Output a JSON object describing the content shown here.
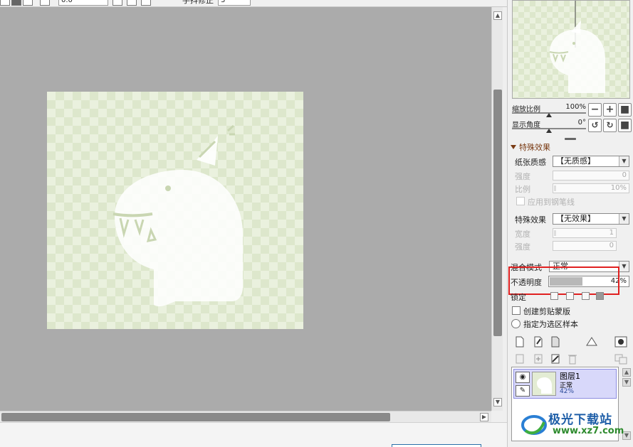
{
  "toolbar": {
    "zoom_field": "0.0",
    "stabilizer_label": "手抖修正",
    "stabilizer_value": "3"
  },
  "navigator": {
    "zoom_label": "缩放比例",
    "zoom_value": "100%",
    "angle_label": "显示角度",
    "angle_value": "0°"
  },
  "special_effects": {
    "section_title": "特殊效果",
    "paper_texture_label": "纸张质感",
    "paper_texture_value": "【无质感】",
    "strength_label": "强度",
    "strength_value": "0",
    "scale_label": "比例",
    "scale_value": "10%",
    "apply_to_pen_label": "应用到钢笔线",
    "effect_label": "特殊效果",
    "effect_value": "【无效果】",
    "width_label": "宽度",
    "width_value": "1",
    "effect_strength_label": "强度",
    "effect_strength_value": "0"
  },
  "layer_props": {
    "blend_mode_label": "混合模式",
    "blend_mode_value": "正常",
    "opacity_label": "不透明度",
    "opacity_value": "42%",
    "opacity_fraction": 0.42,
    "lock_label": "锁定",
    "clipping_label": "创建剪贴蒙版",
    "selection_source_label": "指定为选区样本"
  },
  "layers": [
    {
      "name": "图层1",
      "mode": "正常",
      "opacity": "42%"
    }
  ],
  "watermark": {
    "text": "极光下载站",
    "url": "www.xz7.com"
  },
  "colors": {
    "canvas_bg": "#ababab",
    "checker_light": "#eaf1de",
    "checker_dark": "#dde7cc",
    "highlight": "#e02020",
    "layer_selected": "#d8d8fa"
  }
}
